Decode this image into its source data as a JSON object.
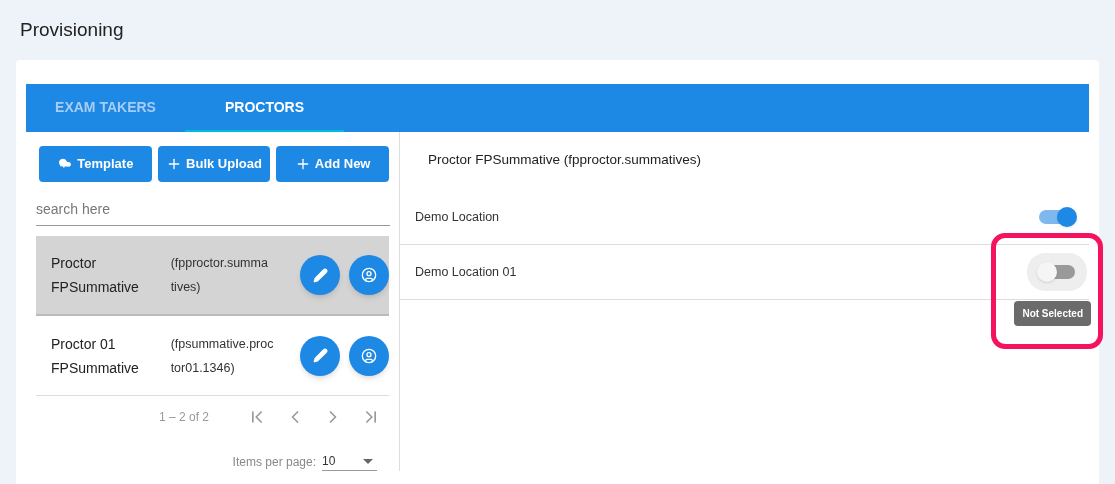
{
  "page_title": "Provisioning",
  "tabs": [
    {
      "label": "EXAM TAKERS",
      "selected": false
    },
    {
      "label": "PROCTORS",
      "selected": true
    }
  ],
  "buttons": [
    {
      "label": "Template",
      "kind": "cloud"
    },
    {
      "label": "Bulk Upload",
      "kind": "plus"
    },
    {
      "label": "Add New",
      "kind": "plus"
    }
  ],
  "search": {
    "placeholder": "search here"
  },
  "proctors": [
    {
      "name": [
        "Proctor",
        "FPSummative"
      ],
      "username": [
        "(fpproctor.summa",
        "tives)"
      ],
      "selected": true
    },
    {
      "name": [
        "Proctor 01",
        "FPSummative"
      ],
      "username": [
        "(fpsummative.proc",
        "tor01.1346)"
      ],
      "selected": false
    }
  ],
  "paginator": {
    "range": "1 – 2 of 2",
    "items_per_page_label": "Items per page:",
    "items_per_page": "10"
  },
  "detail": {
    "title": "Proctor FPSummative (fpproctor.summatives)",
    "locations": [
      {
        "name": "Demo Location",
        "on": true,
        "highlighted": false
      },
      {
        "name": "Demo Location 01",
        "on": false,
        "highlighted": true,
        "tooltip": "Not Selected"
      }
    ]
  }
}
